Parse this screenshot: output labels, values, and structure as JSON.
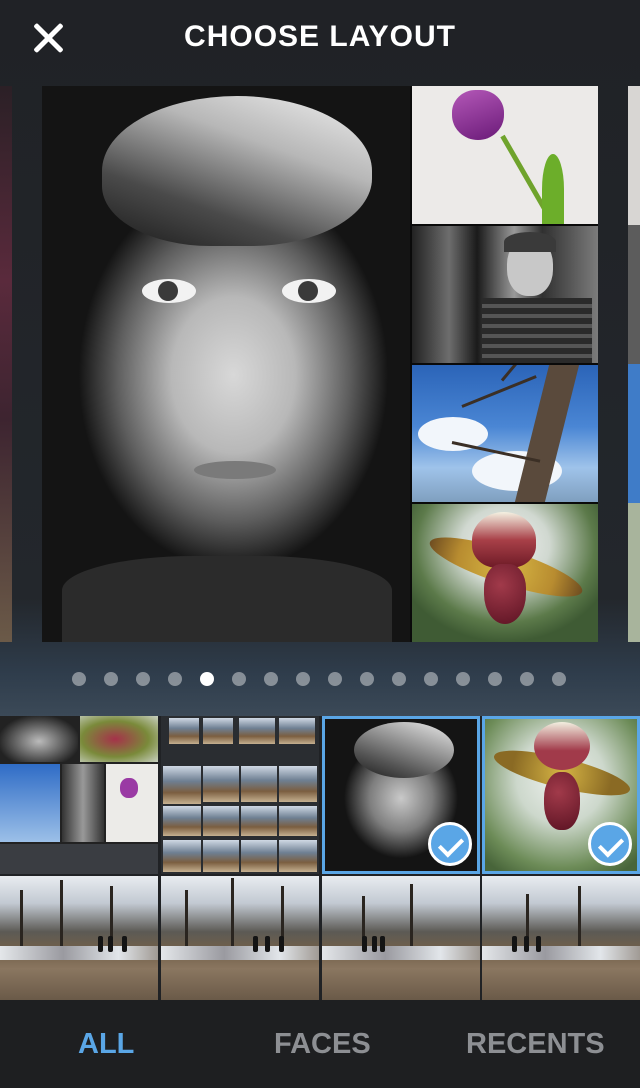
{
  "header": {
    "title": "CHOOSE LAYOUT",
    "close_icon": "close-icon"
  },
  "carousel": {
    "page_count": 16,
    "active_page": 5
  },
  "photo_grid": {
    "selected_count": 2,
    "check_icon": "checkmark-icon"
  },
  "tabs": [
    {
      "label": "ALL",
      "active": true
    },
    {
      "label": "FACES",
      "active": false
    },
    {
      "label": "RECENTS",
      "active": false
    }
  ],
  "colors": {
    "accent": "#5aa6e6",
    "tab_inactive": "#8d8f93",
    "background": "#1f2124"
  }
}
